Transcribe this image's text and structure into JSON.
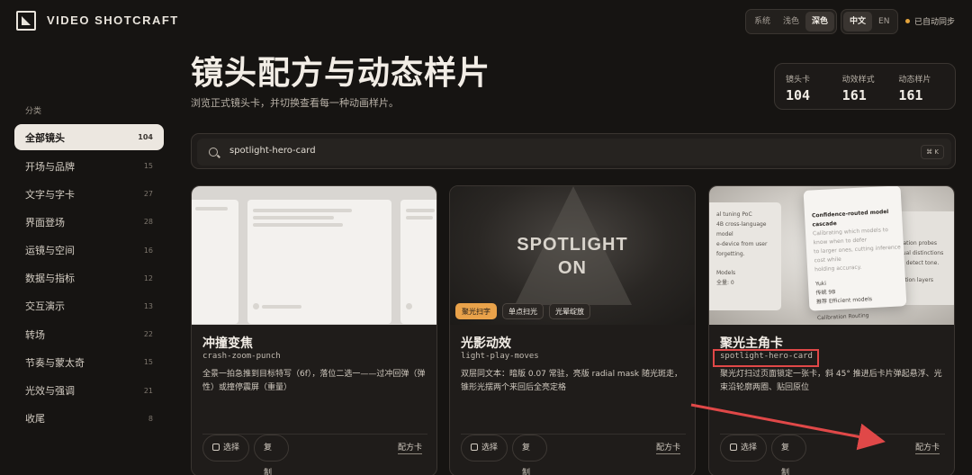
{
  "brand": "VIDEO SHOTCRAFT",
  "theme_options": [
    "系统",
    "浅色",
    "深色"
  ],
  "lang_options": [
    "中文",
    "EN"
  ],
  "sync": "已自动同步",
  "page": {
    "title": "镜头配方与动态样片",
    "subtitle": "浏览正式镜头卡，并切换查看每一种动画样片。"
  },
  "stats": [
    {
      "label": "镜头卡",
      "value": "104"
    },
    {
      "label": "动效样式",
      "value": "161"
    },
    {
      "label": "动态样片",
      "value": "161"
    }
  ],
  "sidebar": {
    "heading": "分类",
    "items": [
      {
        "label": "全部镜头",
        "count": "104"
      },
      {
        "label": "开场与品牌",
        "count": "15"
      },
      {
        "label": "文字与字卡",
        "count": "27"
      },
      {
        "label": "界面登场",
        "count": "28"
      },
      {
        "label": "运镜与空间",
        "count": "16"
      },
      {
        "label": "数据与指标",
        "count": "12"
      },
      {
        "label": "交互演示",
        "count": "13"
      },
      {
        "label": "转场",
        "count": "22"
      },
      {
        "label": "节奏与蒙太奇",
        "count": "15"
      },
      {
        "label": "光效与强调",
        "count": "21"
      },
      {
        "label": "收尾",
        "count": "8"
      }
    ]
  },
  "search": {
    "value": "spotlight-hero-card",
    "shortcut": "⌘ K"
  },
  "cards": [
    {
      "title": "冲撞变焦",
      "slug": "crash-zoom-punch",
      "desc": "全景一拍急推到目标特写（6f），落位二选一——过冲回弹（弹性）或撞停震屏（重量）",
      "select": "选择",
      "copy": "复制",
      "recipe": "配方卡"
    },
    {
      "title": "光影动效",
      "slug": "light-play-moves",
      "desc": "双层同文本：暗版 0.07 常驻，亮版 radial mask 随光斑走，锥形光摆两个来回后全亮定格",
      "select": "选择",
      "copy": "复制",
      "recipe": "配方卡",
      "thumb_text": [
        "SPOTLIGHT",
        "ON"
      ],
      "tags": [
        "聚光扫字",
        "单点扫光",
        "光晕绽放"
      ]
    },
    {
      "title": "聚光主角卡",
      "slug": "spotlight-hero-card",
      "desc": "聚光灯扫过页面锁定一张卡，斜 45° 推进后卡片弹起悬浮、光束沿轮廓两圈、贴回原位",
      "select": "选择",
      "copy": "复制",
      "recipe": "配方卡",
      "thumb": {
        "left": [
          "al tuning PoC",
          "4B cross-language model",
          "e-device from user",
          "forgetting.",
          "Models",
          "全量: 0"
        ],
        "main": [
          "Confidence-routed model cascade",
          "Calibrating which models to know when to defer",
          "to larger ones, cutting inference cost while",
          "holding accuracy.",
          "Yuki",
          "传统",
          "9B",
          "推荐",
          "Efficient models",
          "Calibration",
          "Routing"
        ],
        "right": [
          "ulation probes",
          "rtual distinctions",
          "es detect tone.",
          "nation layers"
        ]
      }
    }
  ]
}
